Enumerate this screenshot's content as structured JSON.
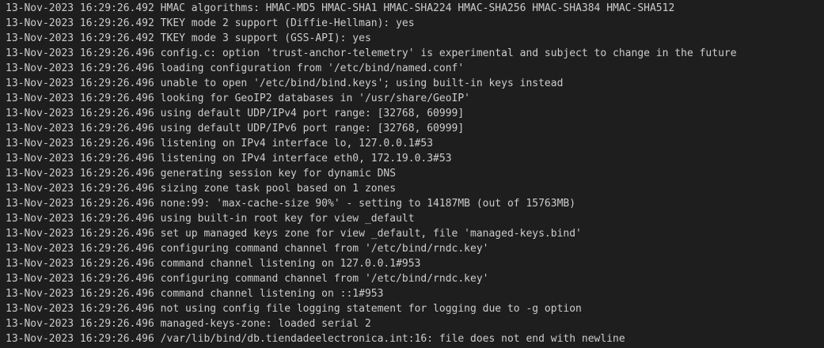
{
  "terminal": {
    "lines": [
      {
        "ts": "13-Nov-2023 16:29:26.492",
        "msg": "HMAC algorithms: HMAC-MD5 HMAC-SHA1 HMAC-SHA224 HMAC-SHA256 HMAC-SHA384 HMAC-SHA512"
      },
      {
        "ts": "13-Nov-2023 16:29:26.492",
        "msg": "TKEY mode 2 support (Diffie-Hellman): yes"
      },
      {
        "ts": "13-Nov-2023 16:29:26.492",
        "msg": "TKEY mode 3 support (GSS-API): yes"
      },
      {
        "ts": "13-Nov-2023 16:29:26.496",
        "msg": "config.c: option 'trust-anchor-telemetry' is experimental and subject to change in the future"
      },
      {
        "ts": "13-Nov-2023 16:29:26.496",
        "msg": "loading configuration from '/etc/bind/named.conf'"
      },
      {
        "ts": "13-Nov-2023 16:29:26.496",
        "msg": "unable to open '/etc/bind/bind.keys'; using built-in keys instead"
      },
      {
        "ts": "13-Nov-2023 16:29:26.496",
        "msg": "looking for GeoIP2 databases in '/usr/share/GeoIP'"
      },
      {
        "ts": "13-Nov-2023 16:29:26.496",
        "msg": "using default UDP/IPv4 port range: [32768, 60999]"
      },
      {
        "ts": "13-Nov-2023 16:29:26.496",
        "msg": "using default UDP/IPv6 port range: [32768, 60999]"
      },
      {
        "ts": "13-Nov-2023 16:29:26.496",
        "msg": "listening on IPv4 interface lo, 127.0.0.1#53"
      },
      {
        "ts": "13-Nov-2023 16:29:26.496",
        "msg": "listening on IPv4 interface eth0, 172.19.0.3#53"
      },
      {
        "ts": "13-Nov-2023 16:29:26.496",
        "msg": "generating session key for dynamic DNS"
      },
      {
        "ts": "13-Nov-2023 16:29:26.496",
        "msg": "sizing zone task pool based on 1 zones"
      },
      {
        "ts": "13-Nov-2023 16:29:26.496",
        "msg": "none:99: 'max-cache-size 90%' - setting to 14187MB (out of 15763MB)"
      },
      {
        "ts": "13-Nov-2023 16:29:26.496",
        "msg": "using built-in root key for view _default"
      },
      {
        "ts": "13-Nov-2023 16:29:26.496",
        "msg": "set up managed keys zone for view _default, file 'managed-keys.bind'"
      },
      {
        "ts": "13-Nov-2023 16:29:26.496",
        "msg": "configuring command channel from '/etc/bind/rndc.key'"
      },
      {
        "ts": "13-Nov-2023 16:29:26.496",
        "msg": "command channel listening on 127.0.0.1#953"
      },
      {
        "ts": "13-Nov-2023 16:29:26.496",
        "msg": "configuring command channel from '/etc/bind/rndc.key'"
      },
      {
        "ts": "13-Nov-2023 16:29:26.496",
        "msg": "command channel listening on ::1#953"
      },
      {
        "ts": "13-Nov-2023 16:29:26.496",
        "msg": "not using config file logging statement for logging due to -g option"
      },
      {
        "ts": "13-Nov-2023 16:29:26.496",
        "msg": "managed-keys-zone: loaded serial 2"
      },
      {
        "ts": "13-Nov-2023 16:29:26.496",
        "msg": "/var/lib/bind/db.tiendadeelectronica.int:16: file does not end with newline"
      }
    ]
  },
  "colors": {
    "background": "#1e1e1e",
    "text": "#cccccc"
  }
}
